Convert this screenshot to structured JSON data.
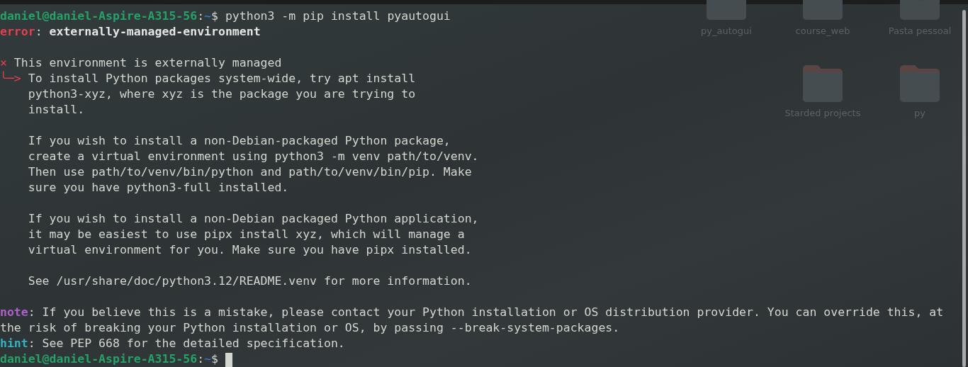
{
  "desktop": {
    "rows": [
      {
        "icons": [
          {
            "label": "py_autogui",
            "kind": "folder"
          },
          {
            "label": "course_web",
            "kind": "folder"
          },
          {
            "label": "Pasta pessoal",
            "kind": "home"
          }
        ]
      },
      {
        "icons": [
          {
            "label": "Starded projects",
            "kind": "folder"
          },
          {
            "label": "py",
            "kind": "folder"
          }
        ]
      }
    ]
  },
  "terminal": {
    "lines": [
      {
        "kind": "text",
        "segments": [
          {
            "kind": "user",
            "text": "daniel@daniel-Aspire-A315-56"
          },
          {
            "kind": "plain",
            "text": ":"
          },
          {
            "kind": "path",
            "text": "~"
          },
          {
            "kind": "plain",
            "text": "$ python3 -m pip install pyautogui"
          }
        ]
      },
      {
        "kind": "text",
        "segments": [
          {
            "kind": "error",
            "text": "error"
          },
          {
            "kind": "plain",
            "text": ": "
          },
          {
            "kind": "bold",
            "text": "externally-managed-environment"
          }
        ]
      },
      {
        "kind": "blank"
      },
      {
        "kind": "text",
        "segments": [
          {
            "kind": "marker",
            "text": "×"
          },
          {
            "kind": "plain",
            "text": " This environment is externally managed"
          }
        ]
      },
      {
        "kind": "text",
        "segments": [
          {
            "kind": "marker",
            "text": "╰─>"
          },
          {
            "kind": "plain",
            "text": " To install Python packages system-wide, try apt install"
          }
        ]
      },
      {
        "kind": "text",
        "segments": [
          {
            "kind": "plain",
            "text": "    python3-xyz, where xyz is the package you are trying to"
          }
        ]
      },
      {
        "kind": "text",
        "segments": [
          {
            "kind": "plain",
            "text": "    install."
          }
        ]
      },
      {
        "kind": "blank"
      },
      {
        "kind": "text",
        "segments": [
          {
            "kind": "plain",
            "text": "    If you wish to install a non-Debian-packaged Python package,"
          }
        ]
      },
      {
        "kind": "text",
        "segments": [
          {
            "kind": "plain",
            "text": "    create a virtual environment using python3 -m venv path/to/venv."
          }
        ]
      },
      {
        "kind": "text",
        "segments": [
          {
            "kind": "plain",
            "text": "    Then use path/to/venv/bin/python and path/to/venv/bin/pip. Make"
          }
        ]
      },
      {
        "kind": "text",
        "segments": [
          {
            "kind": "plain",
            "text": "    sure you have python3-full installed."
          }
        ]
      },
      {
        "kind": "blank"
      },
      {
        "kind": "text",
        "segments": [
          {
            "kind": "plain",
            "text": "    If you wish to install a non-Debian packaged Python application,"
          }
        ]
      },
      {
        "kind": "text",
        "segments": [
          {
            "kind": "plain",
            "text": "    it may be easiest to use pipx install xyz, which will manage a"
          }
        ]
      },
      {
        "kind": "text",
        "segments": [
          {
            "kind": "plain",
            "text": "    virtual environment for you. Make sure you have pipx installed."
          }
        ]
      },
      {
        "kind": "blank"
      },
      {
        "kind": "text",
        "segments": [
          {
            "kind": "plain",
            "text": "    See /usr/share/doc/python3.12/README.venv for more information."
          }
        ]
      },
      {
        "kind": "blank"
      },
      {
        "kind": "text",
        "segments": [
          {
            "kind": "note",
            "text": "note"
          },
          {
            "kind": "plain",
            "text": ": If you believe this is a mistake, please contact your Python installation or OS distribution provider. You can override this, at"
          }
        ]
      },
      {
        "kind": "text",
        "segments": [
          {
            "kind": "plain",
            "text": "the risk of breaking your Python installation or OS, by passing --break-system-packages."
          }
        ]
      },
      {
        "kind": "text",
        "segments": [
          {
            "kind": "hint",
            "text": "hint"
          },
          {
            "kind": "plain",
            "text": ": See PEP 668 for the detailed specification."
          }
        ]
      },
      {
        "kind": "prompt",
        "cursor": true,
        "segments": [
          {
            "kind": "user",
            "text": "daniel@daniel-Aspire-A315-56"
          },
          {
            "kind": "plain",
            "text": ":"
          },
          {
            "kind": "path",
            "text": "~"
          },
          {
            "kind": "plain",
            "text": "$ "
          }
        ]
      }
    ]
  }
}
